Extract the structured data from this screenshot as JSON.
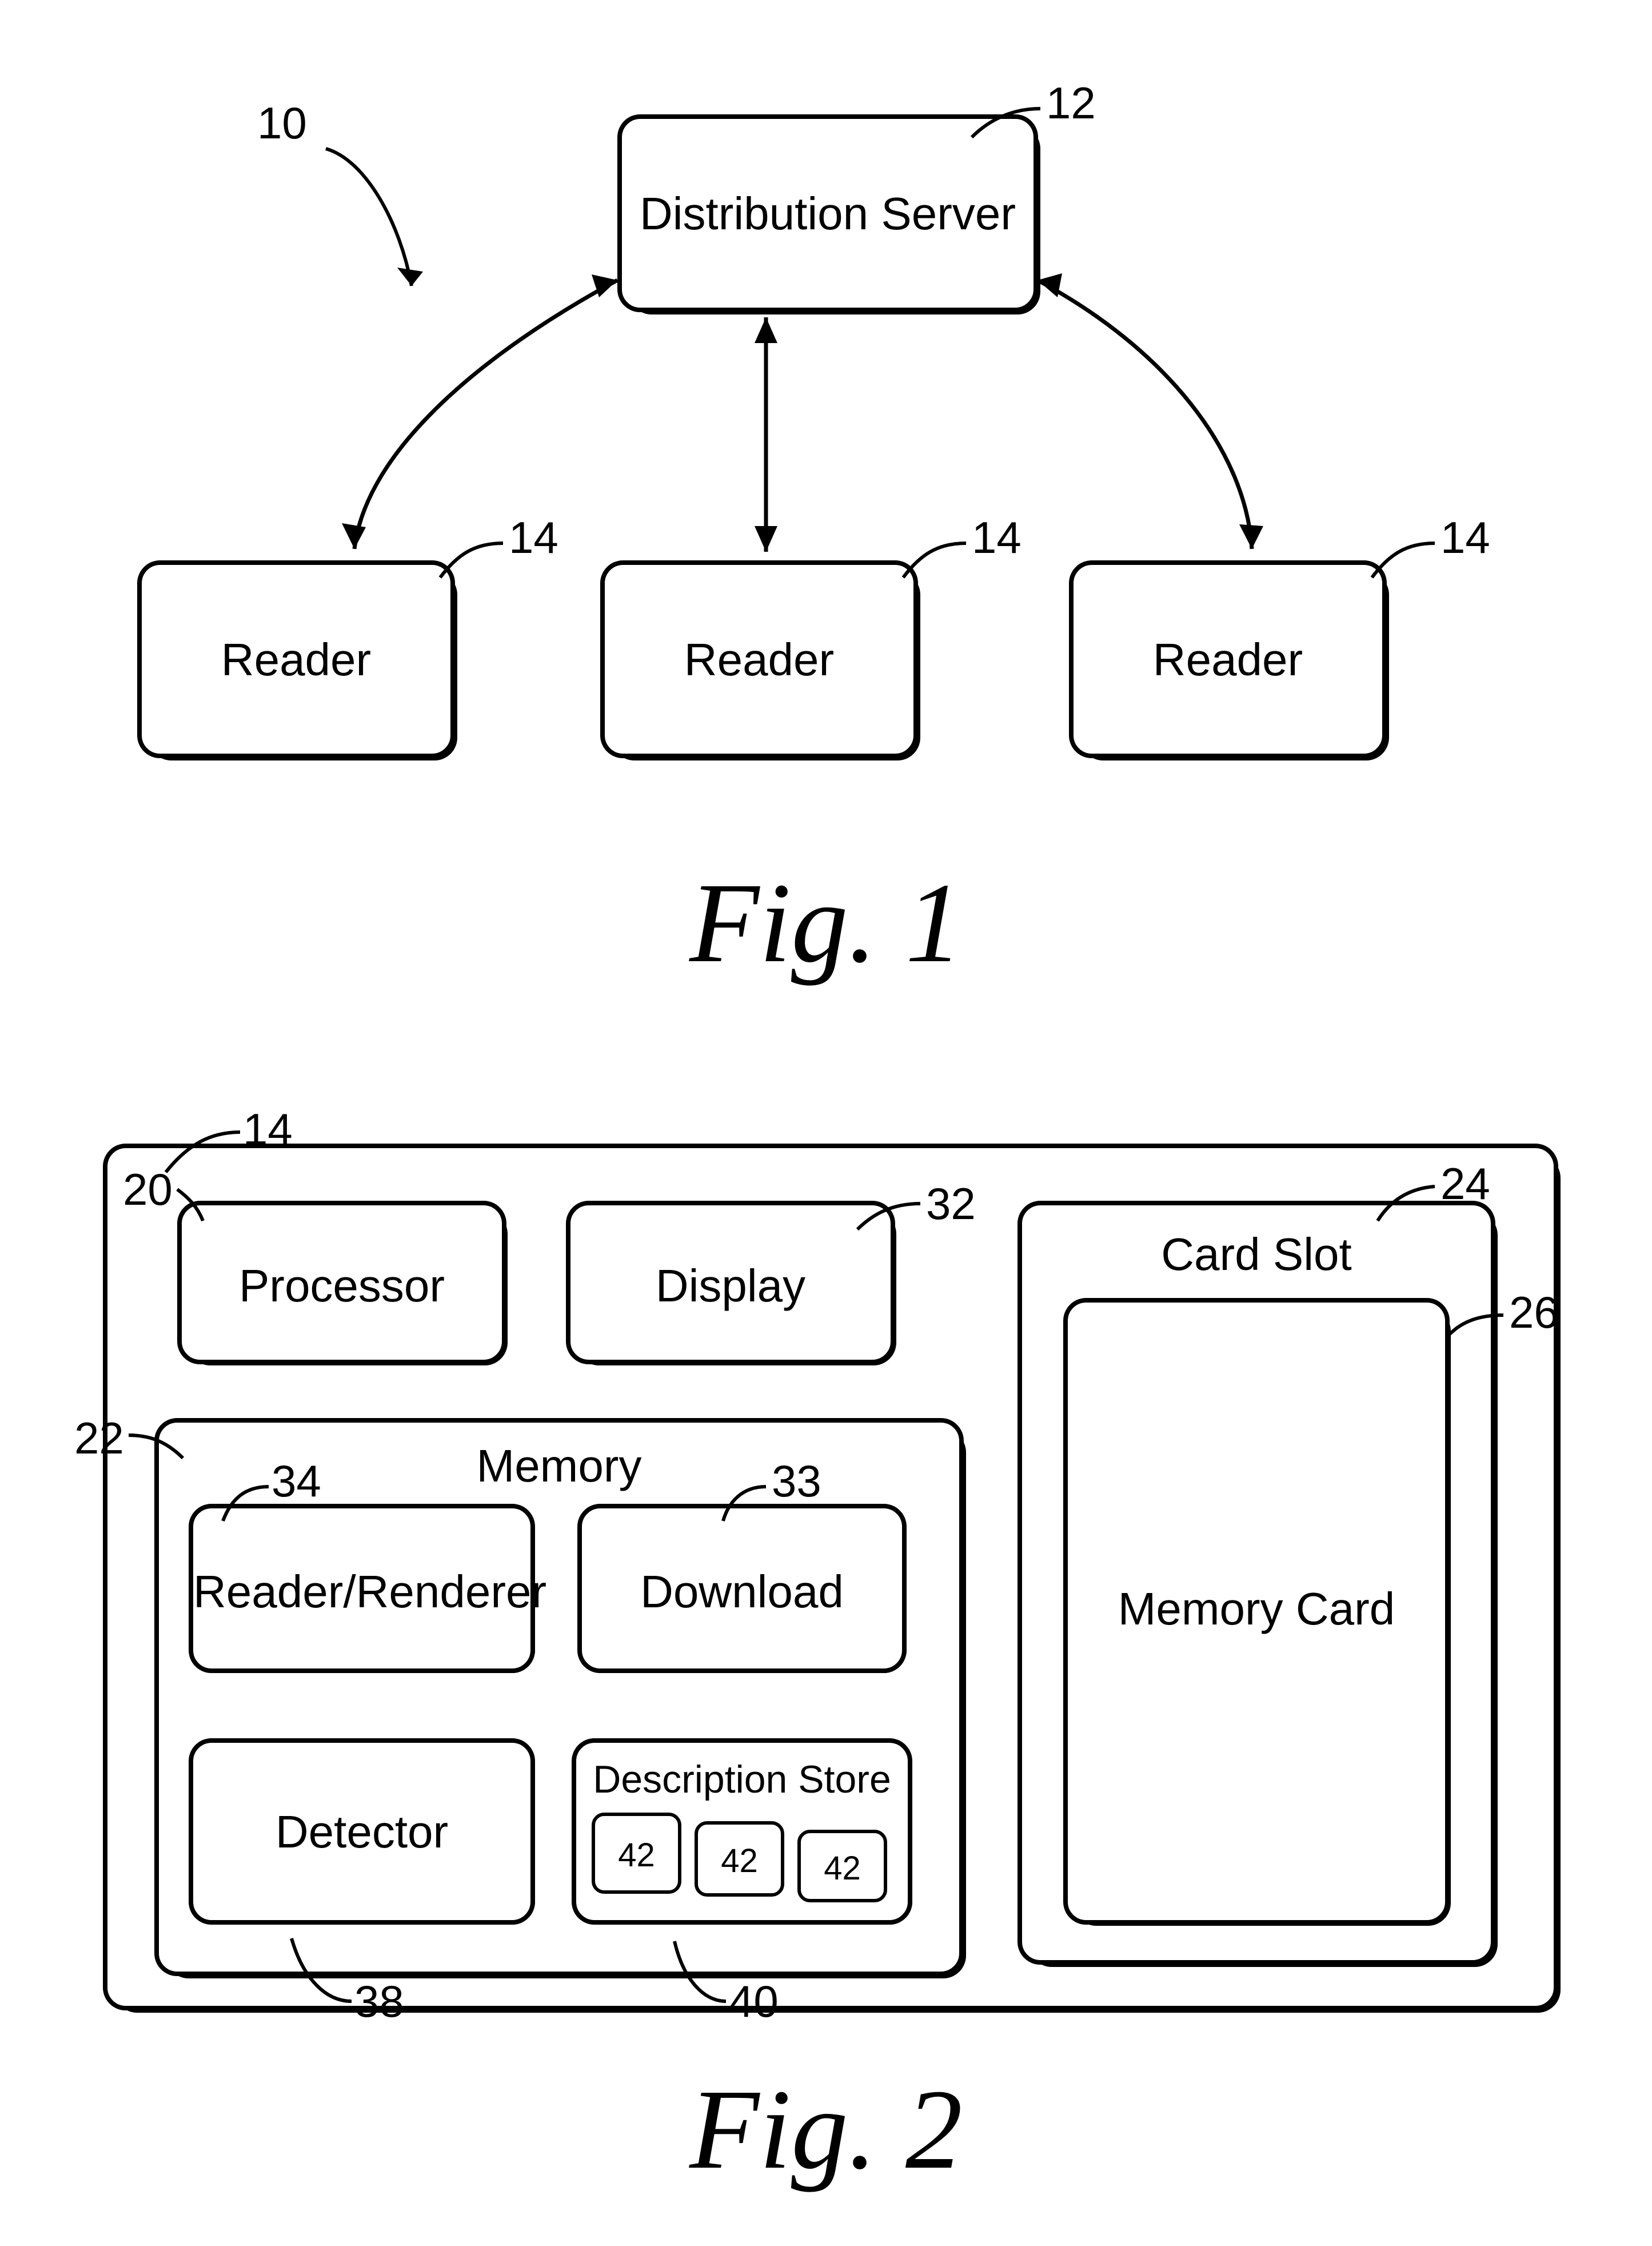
{
  "figure1": {
    "ref_system": "10",
    "server": {
      "label": "Distribution Server",
      "ref": "12"
    },
    "readers": [
      {
        "label": "Reader",
        "ref": "14"
      },
      {
        "label": "Reader",
        "ref": "14"
      },
      {
        "label": "Reader",
        "ref": "14"
      }
    ]
  },
  "figure2": {
    "ref_outer": "14",
    "processor": {
      "label": "Processor",
      "ref": "20"
    },
    "display": {
      "label": "Display",
      "ref": "32"
    },
    "card_slot": {
      "label": "Card Slot",
      "ref": "24"
    },
    "memory_card": {
      "label": "Memory Card",
      "ref": "26"
    },
    "memory_container": {
      "label": "Memory",
      "ref": "22"
    },
    "reader_renderer": {
      "label": "Reader/Renderer",
      "ref": "34"
    },
    "download": {
      "label": "Download",
      "ref": "33"
    },
    "detector": {
      "label": "Detector",
      "ref": "38"
    },
    "description_store": {
      "label": "Description Store",
      "ref": "40"
    },
    "desc_items": [
      {
        "label": "42"
      },
      {
        "label": "42"
      },
      {
        "label": "42"
      }
    ]
  },
  "captions": {
    "fig1": "Fig. 1",
    "fig2": "Fig. 2"
  }
}
